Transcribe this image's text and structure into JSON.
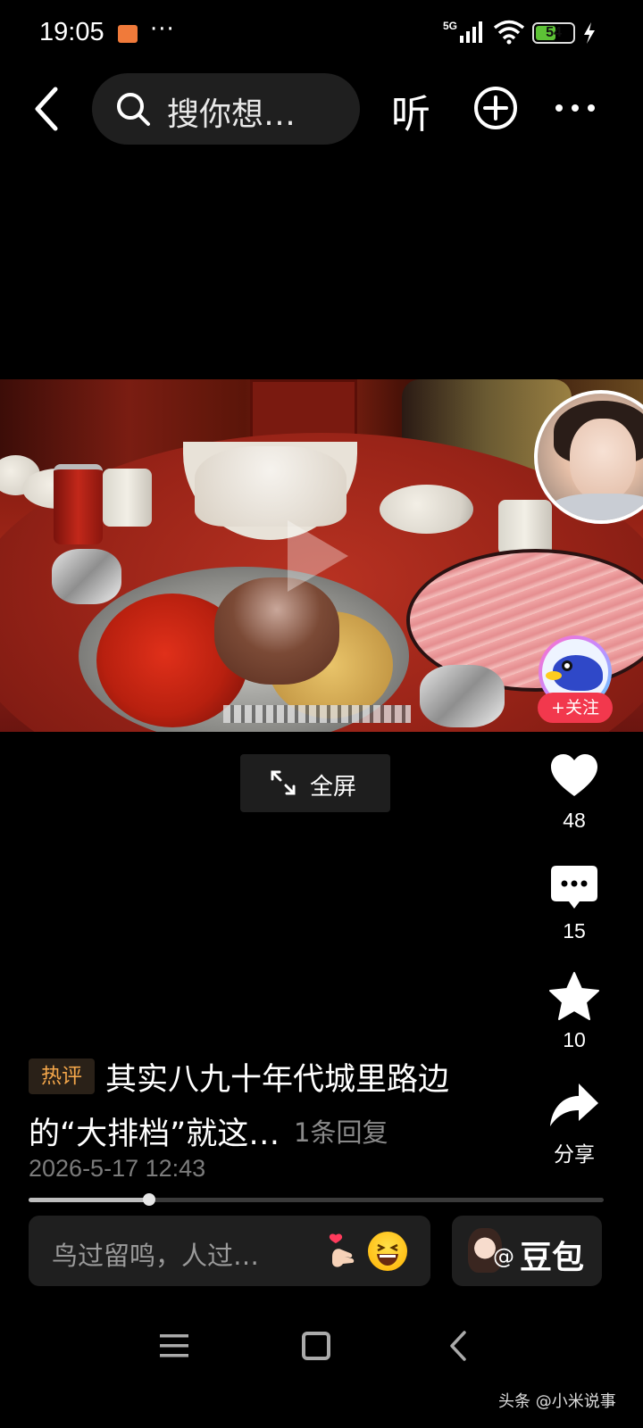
{
  "status_bar": {
    "time": "19:05",
    "more": "···",
    "network": "5G",
    "battery": "54",
    "battery_level": 0.54
  },
  "top_bar": {
    "search_placeholder": "搜你想…",
    "listen_label": "听"
  },
  "video": {
    "follow_label": "+关注"
  },
  "fullscreen": {
    "label": "全屏"
  },
  "actions": {
    "likes": "48",
    "comments": "15",
    "favorites": "10",
    "share_label": "分享"
  },
  "comment": {
    "tag": "热评",
    "line1": "其实八九十年代城里路边",
    "line2": "的“大排档”就这…",
    "replies": "1条回复",
    "date": "2026-5-17 12:43"
  },
  "progress": {
    "fraction": 0.21
  },
  "bottom": {
    "input_placeholder": "鸟过留鸣，人过…",
    "doubao_at": "@",
    "doubao_label": "豆包"
  },
  "watermark": "头条 @小米说事",
  "icons": [
    "back-icon",
    "search-icon",
    "add-icon",
    "more-icon",
    "like-icon",
    "comment-icon",
    "star-icon",
    "share-icon",
    "fullscreen-icon",
    "heart-hand-icon",
    "laugh-icon",
    "menu-icon",
    "home-icon",
    "nav-back-icon"
  ],
  "colors": {
    "accent_red": "#f2384d",
    "tag_orange": "#f3a64a",
    "battery_green": "#5dc236"
  }
}
